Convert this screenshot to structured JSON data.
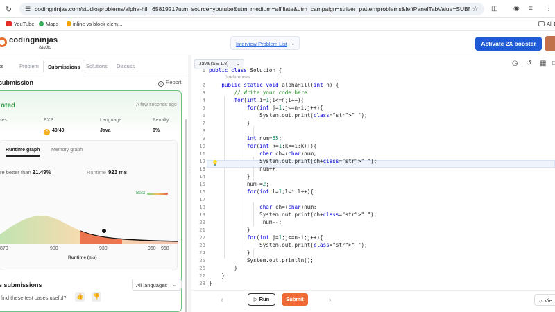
{
  "browser": {
    "url": "codingninjas.com/studio/problems/alpha-hill_6581921?utm_source=youtube&utm_medium=affiliate&utm_campaign=striver_patternproblems&leftPanelTabValue=SUBMISSION",
    "bookmarks": [
      "YouTube",
      "Maps",
      "inline vs block elem...",
      "All B"
    ]
  },
  "header": {
    "logo": "codingninjas",
    "logo_sub": "/studio",
    "interview_list": "Interview Problem List",
    "booster": "Activate 2X booster"
  },
  "left_tabs": [
    "ics",
    "Problem",
    "Submissions",
    "Solutions",
    "Discuss"
  ],
  "submission": {
    "title": "submission",
    "report": "Report",
    "status": "oted",
    "time_ago": "A few seconds ago",
    "stats": [
      {
        "label": "ses",
        "value": ""
      },
      {
        "label": "EXP",
        "value": "40/40"
      },
      {
        "label": "Language",
        "value": "Java"
      },
      {
        "label": "Penalty",
        "value": "0%"
      }
    ],
    "graph_tabs": [
      "Runtime graph",
      "Memory graph"
    ],
    "beats_label": "re better than",
    "beats_value": "21.49%",
    "runtime_label": "Runtime",
    "runtime_value": "923 ms",
    "best_label": "Best"
  },
  "chart_data": {
    "type": "area",
    "x_ticks": [
      "870",
      "900",
      "930",
      "960",
      "968"
    ],
    "xlabel": "Runtime (ms)",
    "marker": {
      "x": 923
    },
    "xlim": [
      860,
      968
    ]
  },
  "feedback": "find these test cases useful?",
  "previous": {
    "title": "s submissions",
    "filter": "All languages"
  },
  "editor": {
    "language": "Java (SE 1.8)",
    "references": "0 references",
    "lines": [
      {
        "n": "1",
        "t": "public class Solution {"
      },
      {
        "n": "2",
        "t": "    public static void alphaHill(int n) {"
      },
      {
        "n": "3",
        "t": "        // Write your code here"
      },
      {
        "n": "4",
        "t": "        for(int i=1;i<=n;i++){"
      },
      {
        "n": "5",
        "t": "            for(int j=1;j<=n-i;j++){"
      },
      {
        "n": "6",
        "t": "                System.out.print(\" \");"
      },
      {
        "n": "7",
        "t": "            }"
      },
      {
        "n": "8",
        "t": ""
      },
      {
        "n": "9",
        "t": "            int num=65;"
      },
      {
        "n": "10",
        "t": "            for(int k=1;k<=i;k++){"
      },
      {
        "n": "11",
        "t": "                char ch=(char)num;"
      },
      {
        "n": "12",
        "t": "                System.out.print(ch+\" \");"
      },
      {
        "n": "13",
        "t": "                num++;"
      },
      {
        "n": "14",
        "t": "            }"
      },
      {
        "n": "15",
        "t": "            num-=2;"
      },
      {
        "n": "16",
        "t": "            for(int l=1;l<i;l++){"
      },
      {
        "n": "17",
        "t": ""
      },
      {
        "n": "18",
        "t": "                char ch=(char)num;"
      },
      {
        "n": "19",
        "t": "                System.out.print(ch+\" \");"
      },
      {
        "n": "20",
        "t": "                 num--;"
      },
      {
        "n": "21",
        "t": "            }"
      },
      {
        "n": "22",
        "t": "            for(int j=1;j<=n-i;j++){"
      },
      {
        "n": "23",
        "t": "                System.out.print(\" \");"
      },
      {
        "n": "24",
        "t": "            }"
      },
      {
        "n": "25",
        "t": "            System.out.println();"
      },
      {
        "n": "26",
        "t": "        }"
      },
      {
        "n": "27",
        "t": "    }"
      },
      {
        "n": "28",
        "t": "}"
      }
    ]
  },
  "actions": {
    "run": "Run",
    "submit": "Submit",
    "view": "Vie"
  },
  "colors": {
    "accent_blue": "#1f5bd7",
    "accepted_green": "#2f9b48",
    "submit_orange": "#f06a35"
  }
}
